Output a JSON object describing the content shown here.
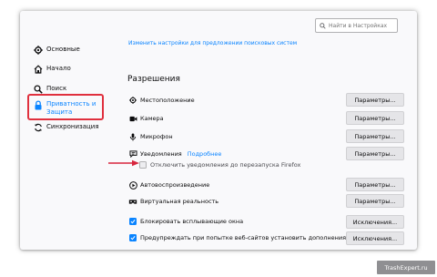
{
  "search": {
    "placeholder": "Найти в Настройках"
  },
  "sidebar": {
    "items": [
      {
        "label": "Основные",
        "icon": "gear-icon"
      },
      {
        "label": "Начало",
        "icon": "home-icon"
      },
      {
        "label": "Поиск",
        "icon": "search-icon"
      },
      {
        "label_line1": "Приватность и",
        "label_line2": "Защита",
        "icon": "lock-icon",
        "active": true
      },
      {
        "label": "Синхронизация",
        "icon": "sync-icon"
      }
    ]
  },
  "main": {
    "search_engine_link": "Изменить настройки для предложении поисковых систем",
    "permissions_title": "Разрешения",
    "permissions": [
      {
        "label": "Местоположение",
        "icon": "location-icon",
        "button": "Параметры..."
      },
      {
        "label": "Камера",
        "icon": "camera-icon",
        "button": "Параметры..."
      },
      {
        "label": "Микрофон",
        "icon": "microphone-icon",
        "button": "Параметры..."
      },
      {
        "label": "Уведомления",
        "icon": "notification-icon",
        "button": "Параметры...",
        "link": "Подробнее"
      }
    ],
    "pause_notifications": {
      "label": "Отключить уведомления до перезапуска Firefox",
      "checked": false
    },
    "permissions_more": [
      {
        "label": "Автовоспроизведение",
        "icon": "autoplay-icon",
        "button": "Параметры..."
      },
      {
        "label": "Виртуальная реальность",
        "icon": "vr-icon",
        "button": "Параметры..."
      }
    ],
    "checkboxes": [
      {
        "label": "Блокировать всплывающие окна",
        "checked": true,
        "button": "Исключения..."
      },
      {
        "label": "Предупреждать при попытке веб-сайтов установить дополнения",
        "checked": true,
        "button": "Исключения..."
      }
    ]
  },
  "watermark": "TrashExpert.ru",
  "colors": {
    "accent": "#0a84ff",
    "highlight": "#e0303e",
    "arrow": "#d7263d"
  }
}
